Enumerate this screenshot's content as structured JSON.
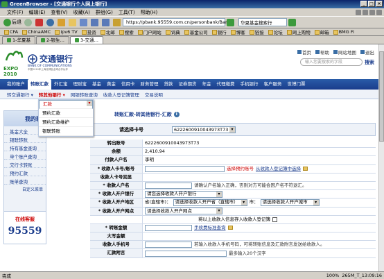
{
  "window": {
    "title": "GreenBrowser - [交通银行个人网上银行]",
    "min": "_",
    "max": "□",
    "close": "×"
  },
  "menu": [
    "文件(F)",
    "编辑(E)",
    "查看(V)",
    "收藏(A)",
    "群组(G)",
    "工具(T)",
    "帮助(H)"
  ],
  "toolbar": {
    "back": "后退",
    "forward": "",
    "address": "https://pbank.95559.com.cn/personbank/Bank",
    "go": "",
    "search_engine": "华夏基金搜索行"
  },
  "favorites": [
    "CFA",
    "ChinaAMC",
    "ipv6 TV",
    "投资",
    "北邮",
    "搜索",
    "门户网站",
    "词典",
    "基金公司",
    "银行",
    "博客",
    "链接",
    "论坛",
    "网上购物",
    "邮箱",
    "BMG Fi"
  ],
  "tabs": [
    {
      "label": "1-华夏基",
      "active": false
    },
    {
      "label": "2-银生…",
      "active": false
    },
    {
      "label": "3-交通…",
      "active": true
    }
  ],
  "bank": {
    "expo_logo": "EXPO 2010",
    "name": "交通银行",
    "name_en": "BANK OF COMMUNICATIONS",
    "sub": "中国2010年上海世博会全球合作伙伴",
    "toplinks": [
      "首页",
      "帮助",
      "网站地图",
      "退出"
    ],
    "search_placeholder": "输入您要搜索的字段",
    "search_button": "搜索"
  },
  "nav": {
    "items": [
      "我的账户",
      "转账汇款",
      "外汇宝",
      "理财宝",
      "基金",
      "黄金",
      "信用卡",
      "财务管理",
      "贷款",
      "证券期货",
      "年金",
      "代理缴费",
      "手机银行",
      "客户服务",
      "世博门票"
    ],
    "active": 1
  },
  "subnav": {
    "items": [
      "转交通银行 ▾",
      "转其他银行 ▾",
      "网银转账查询",
      "收款人登记簿管理",
      "交易说明"
    ],
    "active": 1
  },
  "dropdown": [
    "汇款",
    "预约汇款",
    "预约汇款维护",
    "银联转账"
  ],
  "sidebar": {
    "title": "我的转",
    "items": [
      "基金大全",
      "银联转账",
      "持有基金查询",
      "单个账户查询",
      "交行卡转账",
      "预约汇款",
      "账单查询"
    ],
    "footer": "自定义菜单"
  },
  "hotline": {
    "label": "在线客服",
    "number": "95559"
  },
  "page": {
    "title": "转账汇款-转其他银行-汇款",
    "info_icon": "i",
    "card_label": "请选择卡号",
    "card_value": "6222600910043973T73"
  },
  "form": [
    {
      "label": "转出账号",
      "value": "6222600910043973T73"
    },
    {
      "label": "余额",
      "value": "2,410.94"
    },
    {
      "label": "付款人户名",
      "value": "李明"
    },
    {
      "label": "* 收款人卡号/账号",
      "value": "",
      "extra_red": "选择预约账号",
      "extra_link": "从收款人登记簿中选择"
    },
    {
      "label": "收款人卡号回显",
      "value": ""
    },
    {
      "label": "* 收款人户名",
      "value": "",
      "note": "请确认户名输入正确，否则对方可能会因户名不符退汇。"
    },
    {
      "label": "* 收款人开户银行",
      "select": "请您选择收款人开户银行"
    },
    {
      "label": "* 收款人开户地区",
      "prefix": "省(直辖市)：",
      "select": "请选择收款人开户省（直辖市）",
      "prefix2": "市：",
      "select2": "请选择收款人开户城市"
    },
    {
      "label": "* 收款人开户网点",
      "select": "请选择收款人开户网点"
    },
    {
      "label": "",
      "note": "将以上收款人信息存入收款人登记簿"
    },
    {
      "label": "* 转账金额",
      "link": "手续费标准查询"
    },
    {
      "label": "大写金额",
      "value": ""
    },
    {
      "label": "收款人手机号",
      "note": "若输入收款人手机号码，可将转账信息及汇款附言发送给收款人。"
    },
    {
      "label": "汇款附言",
      "note": "最多输入20个汉字"
    }
  ],
  "status": {
    "left": "完成",
    "right": [
      "100%",
      "265M_T_13:09:16"
    ]
  }
}
